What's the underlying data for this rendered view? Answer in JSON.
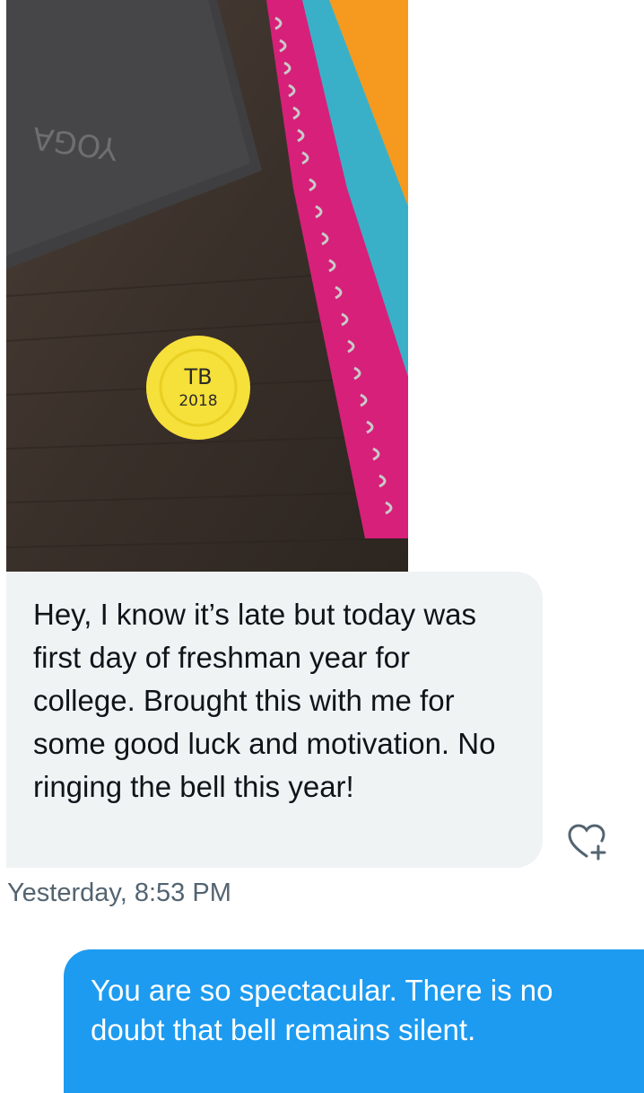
{
  "conversation": {
    "received_message": {
      "photo_alt": "Yellow chip marked TB 2018 on a desk next to a laptop and spiral notebooks",
      "photo_texts": {
        "laptop_brand": "YOGA",
        "chip_line1": "TB",
        "chip_line2": "2018"
      },
      "text": "Hey, I know it’s late but today was first day of freshman year for college. Brought this with me for some good luck and motivation. No ringing the bell this year!",
      "timestamp": "Yesterday, 8:53 PM",
      "react_icon": "heart-plus-icon"
    },
    "sent_message": {
      "text": "You are so spectacular. There is no doubt that bell remains silent."
    }
  },
  "colors": {
    "incoming_bubble": "#eff3f4",
    "outgoing_bubble": "#1d9bf0",
    "primary_text": "#0f1419",
    "secondary_text": "#536471",
    "chip_yellow": "#f6e03a"
  }
}
